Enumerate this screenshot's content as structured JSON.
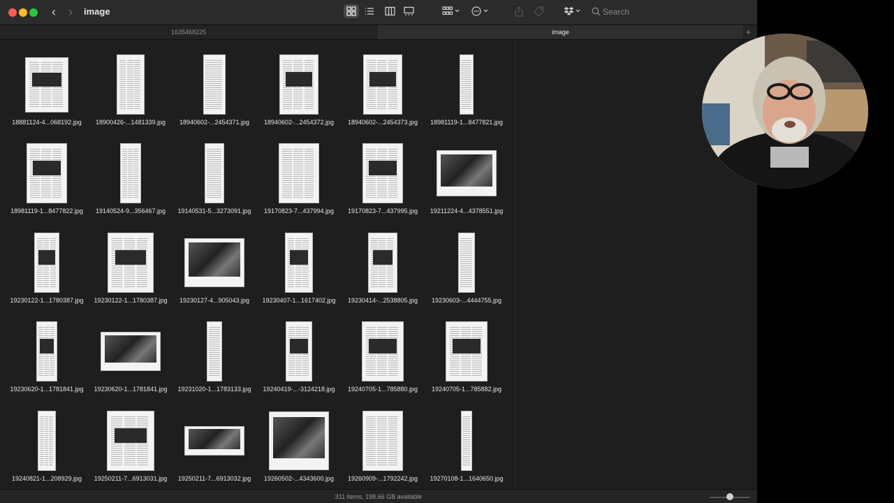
{
  "window": {
    "title": "image"
  },
  "toolbar": {
    "back_icon": "chevron-left-icon",
    "forward_icon": "chevron-right-icon",
    "search_placeholder": "Search"
  },
  "tabs": [
    {
      "label": "1635468225",
      "active": false
    },
    {
      "label": "image",
      "active": true
    }
  ],
  "files": [
    "18881124-4...068192.jpg",
    "18900426-...1481339.jpg",
    "18940602-...2454371.jpg",
    "18940602-...2454372.jpg",
    "18940602-...2454373.jpg",
    "18981119-1...8477821.jpg",
    "18981119-1...8477822.jpg",
    "19140524-9...356467.jpg",
    "19140531-5...3273091.jpg",
    "19170823-7...437994.jpg",
    "19170823-7...437995.jpg",
    "19211224-4...4378551.jpg",
    "19230122-1...1780387.jpg",
    "19230122-1...1780387.jpg",
    "19230127-4...905043.jpg",
    "19230407-1...1617402.jpg",
    "19230414-...2538805.jpg",
    "19230603-...4444755.jpg",
    "19230620-1...1781841.jpg",
    "19230620-1...1781841.jpg",
    "19231020-1...1783133.jpg",
    "19240419-...-3124218.jpg",
    "19240705-1...785880.jpg",
    "19240705-1...785882.jpg",
    "19240821-1...208929.jpg",
    "19250211-7...6913031.jpg",
    "19250211-7...6913032.jpg",
    "19260502-...4343600.jpg",
    "19260909-...1792242.jpg",
    "19270108-1...1640650.jpg"
  ],
  "status": {
    "text": "311 items, 198.66 GB available"
  }
}
